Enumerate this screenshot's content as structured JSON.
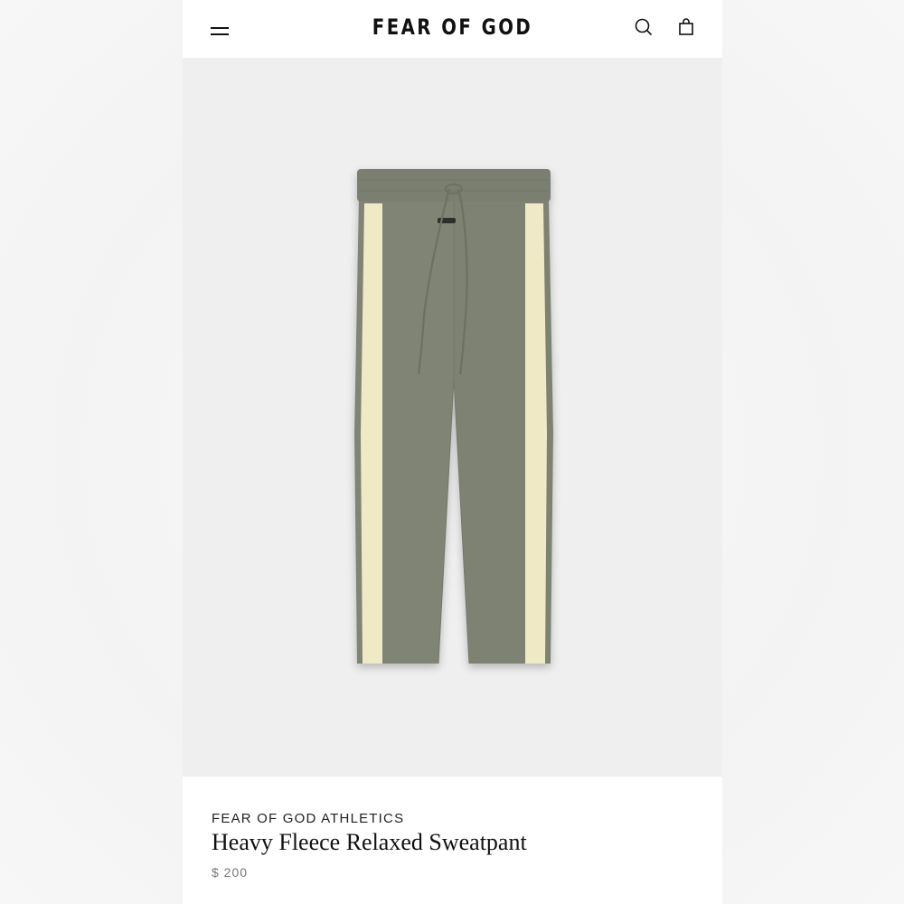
{
  "header": {
    "logo_text": "FEAR OF GOD",
    "menu_icon": "hamburger-menu-icon",
    "search_icon": "search-icon",
    "bag_icon": "shopping-bag-icon"
  },
  "product": {
    "brand": "FEAR OF GOD ATHLETICS",
    "name": "Heavy Fleece Relaxed Sweatpant",
    "price": "$ 200",
    "colors": {
      "pant": "#7f8474",
      "stripe": "#efe9c6",
      "image_bg": "#efefef"
    }
  }
}
